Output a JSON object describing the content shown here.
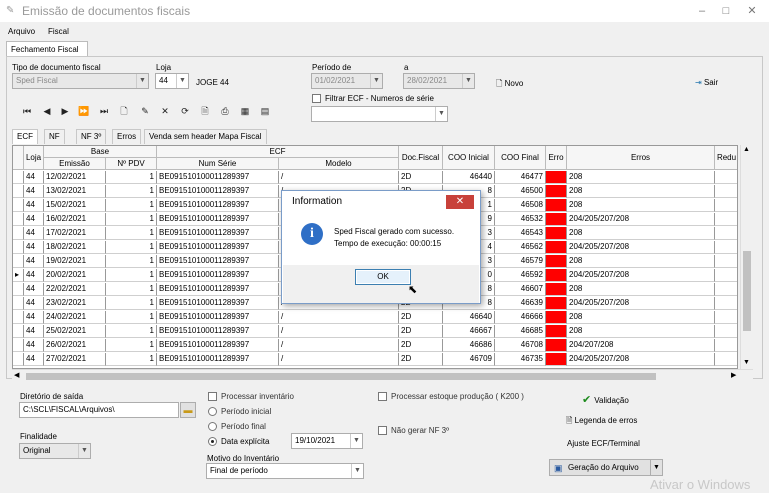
{
  "window": {
    "title": "Emissão de documentos fiscais",
    "minimize": "–",
    "maximize": "□",
    "close": "✕"
  },
  "menu": {
    "items": [
      "Arquivo",
      "Fiscal"
    ]
  },
  "main_tab": "Fechamento Fiscal",
  "form": {
    "tipo_label": "Tipo de documento fiscal",
    "tipo_value": "Sped Fiscal",
    "loja_label": "Loja",
    "loja_value": "44",
    "loja_name": "JOGE 44",
    "periodo_label": "Período de",
    "periodo_de": "01/02/2021",
    "periodo_a_label": "a",
    "periodo_a": "28/02/2021",
    "novo": "Novo",
    "sair": "Sair",
    "filtrar_label": "Filtrar ECF - Numeros de  série"
  },
  "subtabs": [
    "ECF",
    "NF",
    "NF 3º",
    "Erros",
    "Venda sem header Mapa Fiscal"
  ],
  "grid": {
    "group_headers": {
      "base": "Base",
      "ecf": "ECF"
    },
    "columns": [
      "Loja",
      "Emissão",
      "Nº PDV",
      "Num Série",
      "Modelo",
      "Doc.Fiscal",
      "COO Inicial",
      "COO Final",
      "Erro",
      "Erros",
      "Redu"
    ],
    "rows": [
      {
        "loja": "44",
        "emissao": "12/02/2021",
        "pdv": "1",
        "serie": "BE091510100011289397",
        "modelo": "/",
        "doc": "2D",
        "coo_ini": "46440",
        "coo_fim": "46477",
        "erros": "208"
      },
      {
        "loja": "44",
        "emissao": "13/02/2021",
        "pdv": "1",
        "serie": "BE091510100011289397",
        "modelo": "/",
        "doc": "2D",
        "coo_ini": "8",
        "coo_fim": "46500",
        "erros": "208"
      },
      {
        "loja": "44",
        "emissao": "15/02/2021",
        "pdv": "1",
        "serie": "BE091510100011289397",
        "modelo": "/",
        "doc": "2D",
        "coo_ini": "1",
        "coo_fim": "46508",
        "erros": "208"
      },
      {
        "loja": "44",
        "emissao": "16/02/2021",
        "pdv": "1",
        "serie": "BE091510100011289397",
        "modelo": "/",
        "doc": "2D",
        "coo_ini": "9",
        "coo_fim": "46532",
        "erros": "204/205/207/208"
      },
      {
        "loja": "44",
        "emissao": "17/02/2021",
        "pdv": "1",
        "serie": "BE091510100011289397",
        "modelo": "/",
        "doc": "2D",
        "coo_ini": "3",
        "coo_fim": "46543",
        "erros": "208"
      },
      {
        "loja": "44",
        "emissao": "18/02/2021",
        "pdv": "1",
        "serie": "BE091510100011289397",
        "modelo": "/",
        "doc": "2D",
        "coo_ini": "4",
        "coo_fim": "46562",
        "erros": "204/205/207/208"
      },
      {
        "loja": "44",
        "emissao": "19/02/2021",
        "pdv": "1",
        "serie": "BE091510100011289397",
        "modelo": "/",
        "doc": "2D",
        "coo_ini": "3",
        "coo_fim": "46579",
        "erros": "208"
      },
      {
        "loja": "44",
        "emissao": "20/02/2021",
        "pdv": "1",
        "serie": "BE091510100011289397",
        "modelo": "/",
        "doc": "2D",
        "coo_ini": "0",
        "coo_fim": "46592",
        "erros": "204/205/207/208"
      },
      {
        "loja": "44",
        "emissao": "22/02/2021",
        "pdv": "1",
        "serie": "BE091510100011289397",
        "modelo": "/",
        "doc": "2D",
        "coo_ini": "8",
        "coo_fim": "46607",
        "erros": "208"
      },
      {
        "loja": "44",
        "emissao": "23/02/2021",
        "pdv": "1",
        "serie": "BE091510100011289397",
        "modelo": "/",
        "doc": "2D",
        "coo_ini": "8",
        "coo_fim": "46639",
        "erros": "204/205/207/208"
      },
      {
        "loja": "44",
        "emissao": "24/02/2021",
        "pdv": "1",
        "serie": "BE091510100011289397",
        "modelo": "/",
        "doc": "2D",
        "coo_ini": "46640",
        "coo_fim": "46666",
        "erros": "208"
      },
      {
        "loja": "44",
        "emissao": "25/02/2021",
        "pdv": "1",
        "serie": "BE091510100011289397",
        "modelo": "/",
        "doc": "2D",
        "coo_ini": "46667",
        "coo_fim": "46685",
        "erros": "208"
      },
      {
        "loja": "44",
        "emissao": "26/02/2021",
        "pdv": "1",
        "serie": "BE091510100011289397",
        "modelo": "/",
        "doc": "2D",
        "coo_ini": "46686",
        "coo_fim": "46708",
        "erros": "204/207/208"
      },
      {
        "loja": "44",
        "emissao": "27/02/2021",
        "pdv": "1",
        "serie": "BE091510100011289397",
        "modelo": "/",
        "doc": "2D",
        "coo_ini": "46709",
        "coo_fim": "46735",
        "erros": "204/205/207/208"
      }
    ]
  },
  "bottom": {
    "diretorio_label": "Diretório de saída",
    "diretorio_value": "C:\\SCL\\FISCAL\\Arquivos\\",
    "finalidade_label": "Finalidade",
    "finalidade_value": "Original",
    "processar_inventario": "Processar inventário",
    "periodo_inicial": "Período inicial",
    "periodo_final": "Período final",
    "data_explicita": "Data explícita",
    "data_value": "19/10/2021",
    "motivo_label": "Motivo do Inventário",
    "motivo_value": "Final de período",
    "processar_estoque": "Processar estoque produção ( K200 )",
    "nao_gerar": "Não gerar NF 3º",
    "validacao": "Validação",
    "legenda": "Legenda de erros",
    "ajuste": "Ajuste ECF/Terminal",
    "geracao": "Geração do Arquivo"
  },
  "dialog": {
    "title": "Information",
    "message1": "Sped Fiscal gerado com sucesso.",
    "message2": "Tempo de execução: 00:00:15",
    "ok": "OK"
  },
  "watermark": "Ativar o Windows",
  "colors": {
    "error_cell": "#ff0000",
    "dialog_close": "#c8413a",
    "info_icon": "#2f6fc6"
  }
}
